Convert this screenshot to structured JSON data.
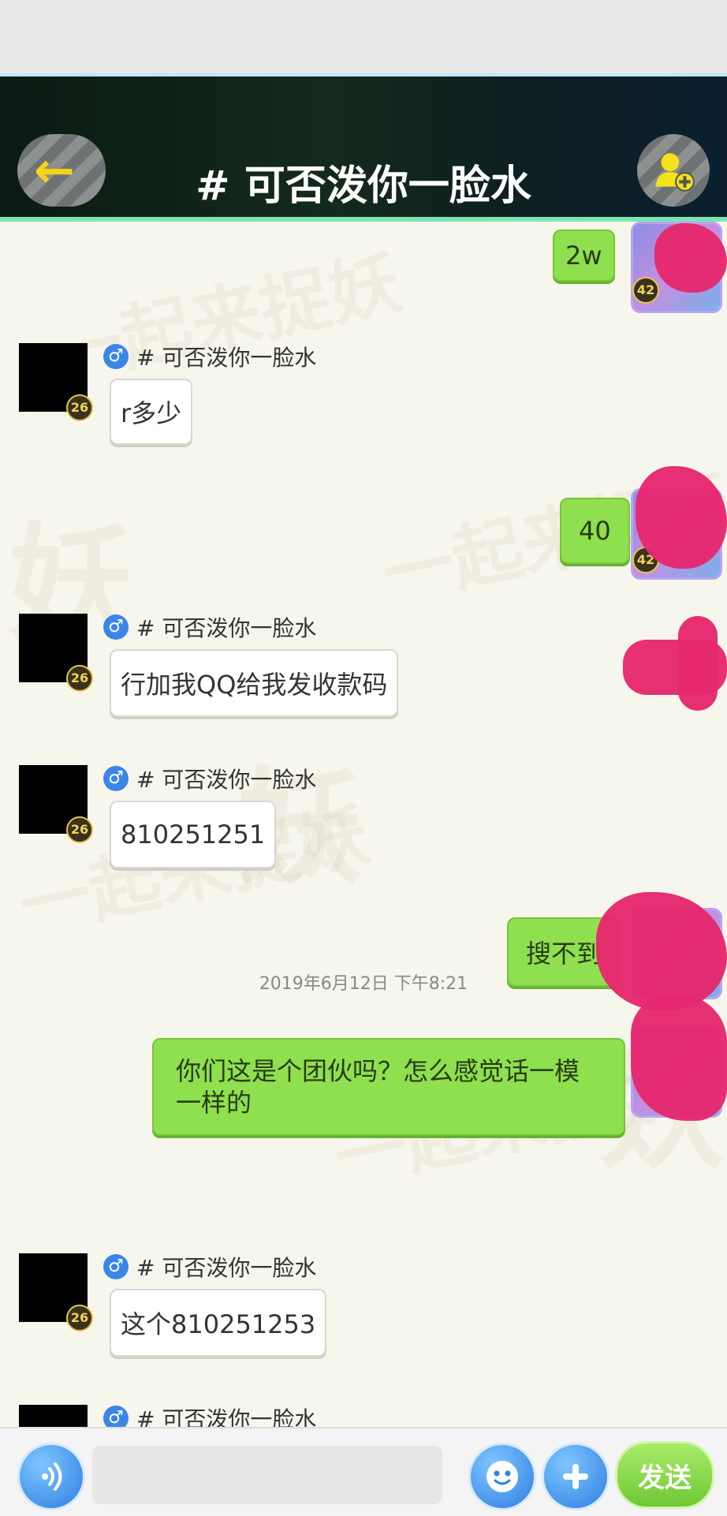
{
  "header": {
    "title": "# 可否泼你一脸水",
    "back_icon": "back-arrow-icon",
    "add_friend_icon": "add-friend-icon"
  },
  "messages": [
    {
      "side": "right",
      "text": "2w"
    },
    {
      "side": "left",
      "name": "# 可否泼你一脸水",
      "level": "26",
      "text": "r多少"
    },
    {
      "side": "right",
      "text": "40"
    },
    {
      "side": "left",
      "name": "# 可否泼你一脸水",
      "level": "26",
      "text": "行加我QQ给我发收款码"
    },
    {
      "side": "left",
      "name": "# 可否泼你一脸水",
      "level": "26",
      "text": "810251251"
    },
    {
      "side": "right",
      "text": "搜不到"
    },
    {
      "side": "right",
      "text": "你们这是个团伙吗？怎么感觉话一模一样的"
    },
    {
      "side": "left",
      "name": "# 可否泼你一脸水",
      "level": "26",
      "text": "这个810251253"
    },
    {
      "side": "left",
      "name": "# 可否泼你一脸水",
      "level": "",
      "text": ""
    }
  ],
  "self_level": "42",
  "timestamp": "2019年6月12日 下午8:21",
  "input": {
    "placeholder": "",
    "value": ""
  },
  "toolbar": {
    "voice_icon": "voice-icon",
    "emoji_icon": "emoji-icon",
    "plus_icon": "plus-icon",
    "send_label": "发送"
  },
  "colors": {
    "bubble_self": "#8ee04e",
    "bubble_other": "#ffffff",
    "redaction": "#e6286e",
    "header_accent": "#7fe3b0"
  }
}
